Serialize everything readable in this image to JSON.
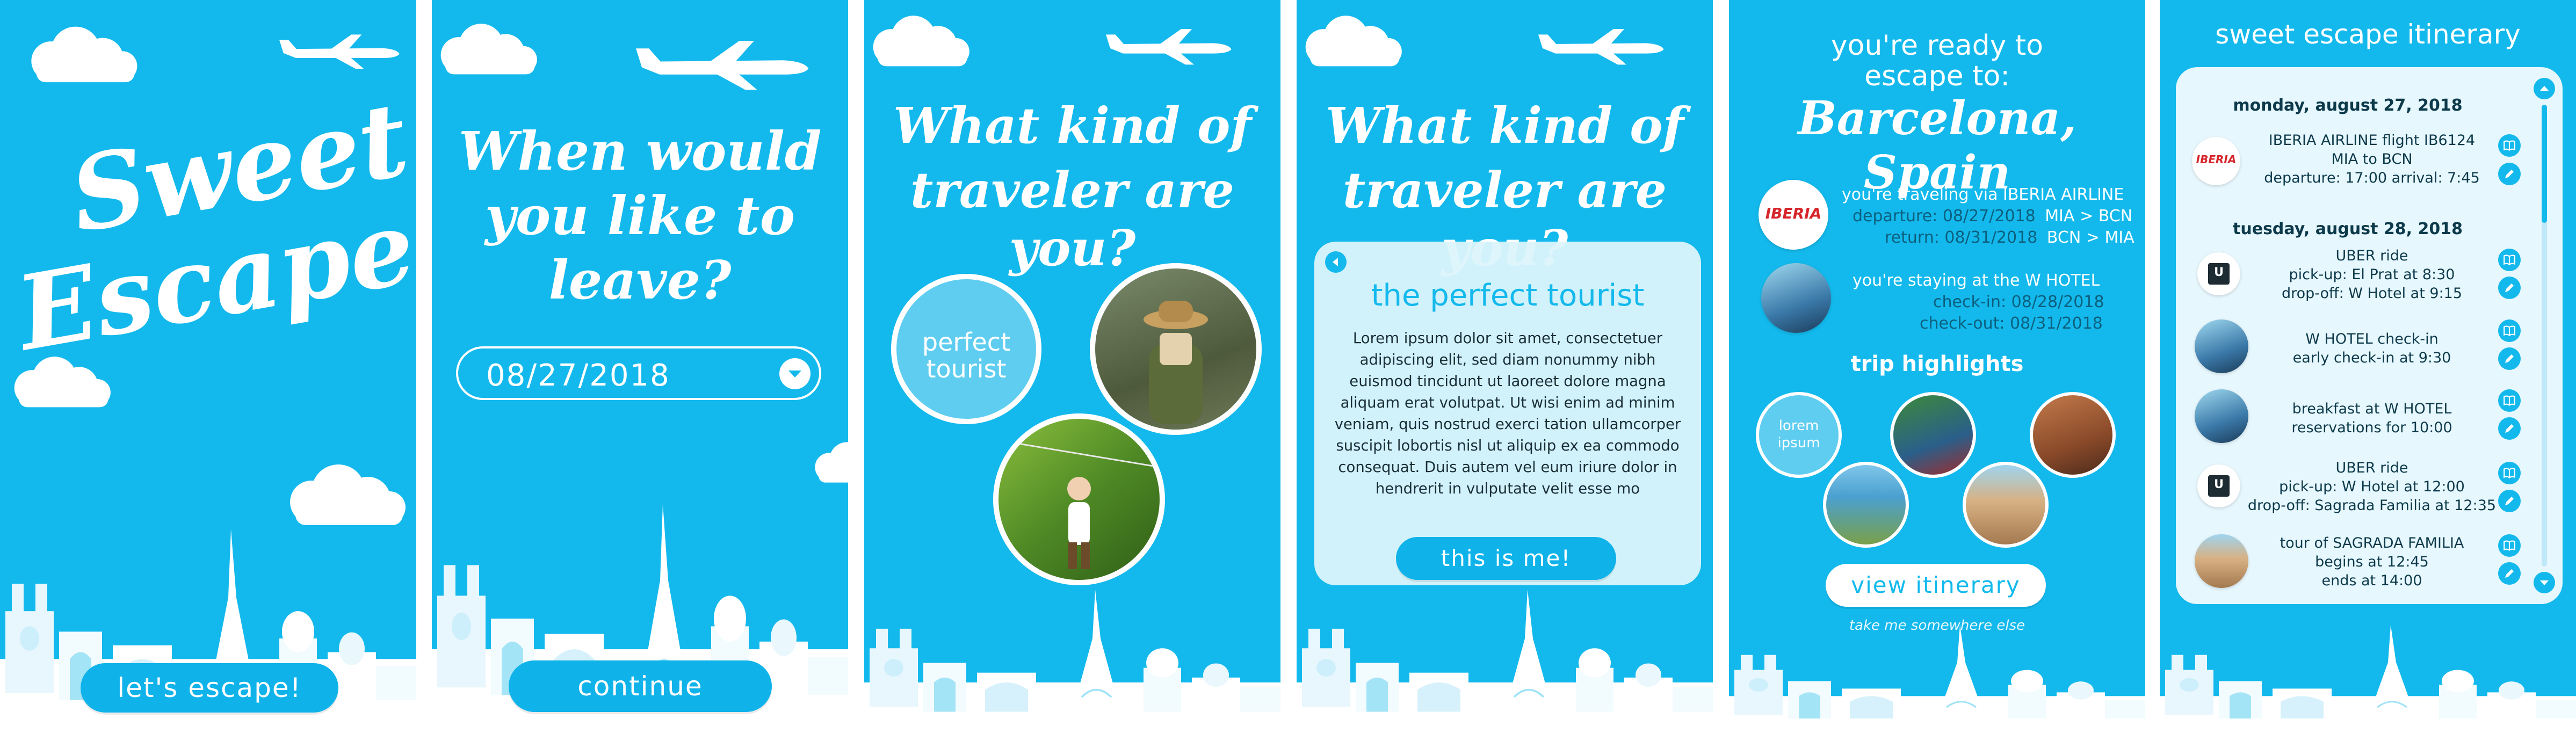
{
  "colors": {
    "sky": "#13b9ec",
    "white": "#ffffff",
    "dark": "#0d3a4b",
    "uber": "#1d2b33",
    "iberia": "#d6252b"
  },
  "panel1": {
    "title_line1": "Sweet",
    "title_line2": "Escape",
    "button": "let's escape!"
  },
  "panel2": {
    "title_line1": "When would",
    "title_line2": "you like to",
    "title_line3": "leave?",
    "date_value": "08/27/2018",
    "button": "continue"
  },
  "panel3": {
    "title_line1": "What kind of",
    "title_line2": "traveler are you?",
    "option_label_line1": "perfect",
    "option_label_line2": "tourist"
  },
  "panel4": {
    "title_line1": "What kind of",
    "title_line2": "traveler are you?",
    "card_title": "the perfect tourist",
    "card_body": "Lorem ipsum dolor sit amet, consectetuer adipiscing elit, sed diam nonummy nibh euismod tincidunt ut laoreet dolore magna aliquam erat volutpat. Ut wisi enim ad minim veniam, quis nostrud exerci tation ullamcorper suscipit lobortis nisl ut aliquip ex ea commodo consequat. Duis autem vel eum iriure dolor in hendrerit in vulputate velit esse mo",
    "button": "this is me!"
  },
  "panel5": {
    "intro_line1": "you're ready to",
    "intro_line2": "escape to:",
    "destination": "Barcelona, Spain",
    "airline_logo": "IBERIA",
    "flight_line": "you're traveling via IBERIA AIRLINE",
    "departure_label": "departure: 08/27/2018",
    "departure_route": "MIA > BCN",
    "return_label": "return: 08/31/2018",
    "return_route": "BCN > MIA",
    "hotel_line": "you're staying at the W HOTEL",
    "checkin": "check-in: 08/28/2018",
    "checkout": "check-out: 08/31/2018",
    "highlights_title": "trip highlights",
    "highlight_bubble_line1": "lorem",
    "highlight_bubble_line2": "ipsum",
    "button": "view itinerary",
    "alt_link": "take me somewhere else"
  },
  "panel6": {
    "title": "sweet escape itinerary",
    "days": [
      {
        "date": "monday, august 27, 2018"
      },
      {
        "date": "tuesday, august 28, 2018"
      }
    ],
    "items": [
      {
        "icon": "iberia-logo",
        "line1": "IBERIA AIRLINE flight IB6124",
        "line2": "MIA to BCN",
        "line3": "departure: 17:00   arrival: 7:45"
      },
      {
        "icon": "uber-logo",
        "line1": "UBER ride",
        "line2": "pick-up: El Prat at 8:30",
        "line3": "drop-off: W Hotel at 9:15"
      },
      {
        "icon": "hotel-photo",
        "line1": "W HOTEL check-in",
        "line2": "early check-in at 9:30",
        "line3": ""
      },
      {
        "icon": "hotel-photo",
        "line1": "breakfast at W HOTEL",
        "line2": "reservations for 10:00",
        "line3": ""
      },
      {
        "icon": "uber-logo",
        "line1": "UBER ride",
        "line2": "pick-up: W Hotel at 12:00",
        "line3": "drop-off: Sagrada Familia at 12:35"
      },
      {
        "icon": "sagrada-photo",
        "line1": "tour of SAGRADA FAMILIA",
        "line2": "begins at 12:45",
        "line3": "ends at 14:00"
      }
    ],
    "uber_logo_text": "U",
    "iberia_logo_text": "IBERIA"
  },
  "icons": {
    "book": "book-icon",
    "edit": "pencil-icon",
    "chevron_down": "chevron-down-icon",
    "chevron_left": "chevron-left-icon"
  }
}
